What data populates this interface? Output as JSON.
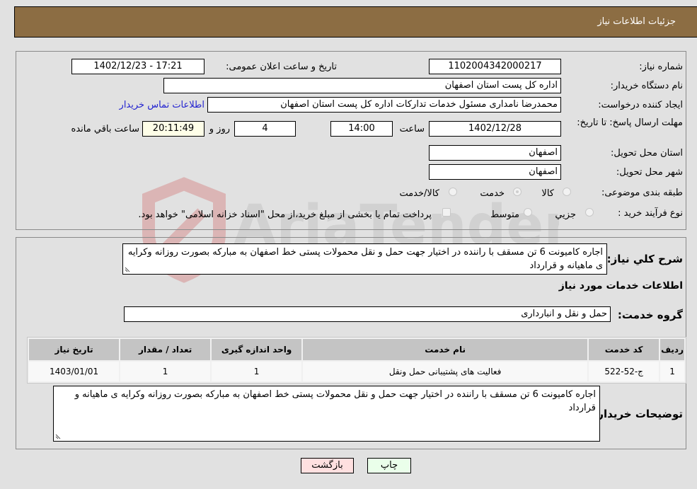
{
  "header": {
    "title": "جزئیات اطلاعات نیاز"
  },
  "form": {
    "need_number": {
      "label": "شماره نیاز:",
      "value": "1102004342000217"
    },
    "announce_datetime": {
      "label": "تاریخ و ساعت اعلان عمومی:",
      "value": "1402/12/23 - 17:21"
    },
    "buyer_org": {
      "label": "نام دستگاه خریدار:",
      "value": "اداره کل پست استان اصفهان"
    },
    "requester": {
      "label": "ایجاد کننده درخواست:",
      "value": "محمدرضا نامداری مسئول خدمات تدارکات اداره کل پست استان اصفهان"
    },
    "contact_link": "اطلاعات تماس خریدار",
    "deadline": {
      "label": "مهلت ارسال پاسخ: تا تاریخ:",
      "date": "1402/12/28",
      "time_label": "ساعت",
      "time": "14:00",
      "days": "4",
      "days_label": "روز و",
      "remaining": "20:11:49",
      "remaining_label": "ساعت باقي مانده"
    },
    "province": {
      "label": "استان محل تحویل:",
      "value": "اصفهان"
    },
    "city": {
      "label": "شهر محل تحویل:",
      "value": "اصفهان"
    },
    "category": {
      "label": "طبقه بندی موضوعی:",
      "options": [
        "کالا",
        "خدمت",
        "کالا/خدمت"
      ],
      "selected": "خدمت"
    },
    "purchase_process": {
      "label": "نوع فرآیند خرید :",
      "options": [
        "جزيي",
        "متوسط"
      ],
      "treasury_note": "پرداخت تمام یا بخشی از مبلغ خرید،از محل \"اسناد خزانه اسلامی\" خواهد بود."
    }
  },
  "details": {
    "summary_label": "شرح کلي نياز:",
    "summary": "اجاره کامیونت 6 تن مسقف با راننده در اختیار جهت حمل و نقل محمولات پستی خط اصفهان به مبارکه بصورت روزانه وکرایه ی ماهیانه و قرارداد",
    "services_title": "اطلاعات خدمات مورد نیاز",
    "service_group_label": "گروه خدمت:",
    "service_group": "حمل و نقل و انبارداری",
    "table": {
      "headers": [
        "ردیف",
        "کد خدمت",
        "نام خدمت",
        "واحد اندازه گیری",
        "تعداد / مقدار",
        "تاریخ نیاز"
      ],
      "rows": [
        [
          "1",
          "ج-52-522",
          "فعالیت های پشتیبانی حمل ونقل",
          "1",
          "1",
          "1403/01/01"
        ]
      ]
    },
    "buyer_notes_label": "توضیحات خریدار:",
    "buyer_notes": "اجاره کامیونت 6 تن مسقف با راننده در اختیار جهت حمل و نقل محمولات پستی خط اصفهان به مبارکه بصورت روزانه وکرایه ی ماهیانه و قرارداد"
  },
  "buttons": {
    "print": "چاپ",
    "back": "بازگشت"
  },
  "colors": {
    "header": "#8c6d43",
    "print_bg": "#eaffea",
    "back_bg": "#ffe0e0",
    "link": "#2323d0"
  }
}
